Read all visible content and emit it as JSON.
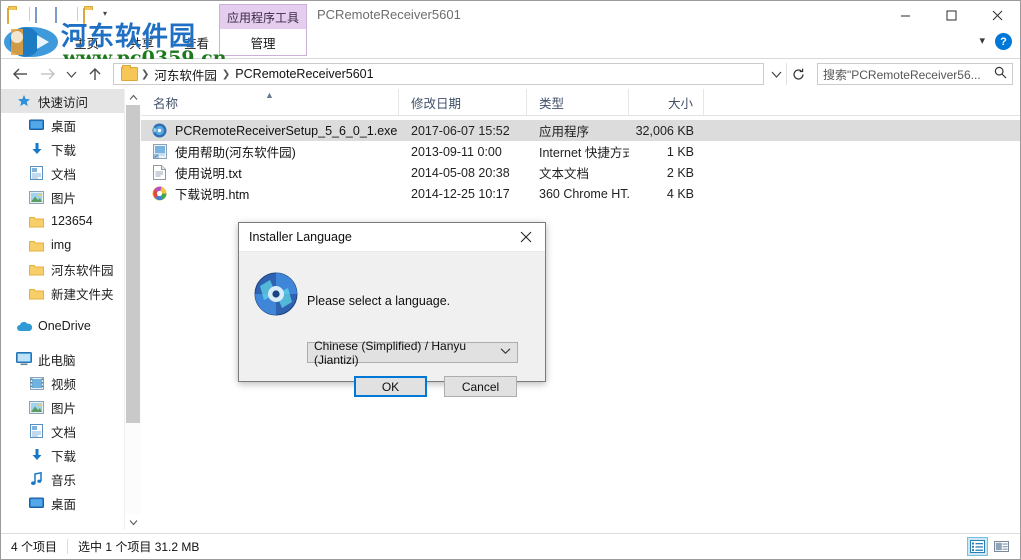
{
  "window": {
    "title": "PCRemoteReceiver5601",
    "controls": {
      "minimize": "minimize-icon",
      "maximize": "maximize-icon",
      "close": "close-icon"
    },
    "ribbon_toggle": "chevron-down-icon",
    "help": "?"
  },
  "ribbon": {
    "tabs": [
      {
        "label": "主页",
        "active": false
      },
      {
        "label": "共享",
        "active": false
      },
      {
        "label": "查看",
        "active": false
      }
    ],
    "contextual": {
      "group_label": "应用程序工具",
      "tab_label": "管理",
      "accent": "#e4cdee"
    }
  },
  "address_bar": {
    "back": "back-arrow-icon",
    "forward": "forward-arrow-icon",
    "recent": "chevron-down-icon",
    "up": "up-arrow-icon",
    "crumbs": [
      "河东软件园",
      "PCRemoteReceiver5601"
    ],
    "dropdown": "chevron-down-icon",
    "refresh": "refresh-icon",
    "search": {
      "value": "搜索\"PCRemoteReceiver56...",
      "placeholder": "搜索\"PCRemoteReceiver56...",
      "icon": "search-icon"
    }
  },
  "sidebar": {
    "quick_access": {
      "label": "快速访问",
      "icon": "star-icon",
      "selected": true
    },
    "items": [
      {
        "label": "桌面",
        "icon": "desktop-icon",
        "pinned": true,
        "level": 1
      },
      {
        "label": "下载",
        "icon": "download-icon",
        "pinned": true,
        "level": 1
      },
      {
        "label": "文档",
        "icon": "documents-icon",
        "pinned": true,
        "level": 1
      },
      {
        "label": "图片",
        "icon": "pictures-icon",
        "pinned": true,
        "level": 1
      },
      {
        "label": "123654",
        "icon": "folder-icon",
        "pinned": false,
        "level": 1
      },
      {
        "label": "img",
        "icon": "folder-icon",
        "pinned": false,
        "level": 1
      },
      {
        "label": "河东软件园",
        "icon": "folder-icon",
        "pinned": false,
        "level": 1
      },
      {
        "label": "新建文件夹",
        "icon": "folder-icon",
        "pinned": false,
        "level": 1
      }
    ],
    "onedrive": {
      "label": "OneDrive",
      "icon": "cloud-icon"
    },
    "this_pc": {
      "label": "此电脑",
      "icon": "computer-icon"
    },
    "this_pc_children": [
      {
        "label": "视频",
        "icon": "videos-icon"
      },
      {
        "label": "图片",
        "icon": "pictures-icon"
      },
      {
        "label": "文档",
        "icon": "documents-icon"
      },
      {
        "label": "下载",
        "icon": "download-icon"
      },
      {
        "label": "音乐",
        "icon": "music-icon"
      },
      {
        "label": "桌面",
        "icon": "desktop-icon"
      }
    ],
    "scroll_up": "chevron-up-icon",
    "scroll_down": "chevron-down-icon"
  },
  "file_list": {
    "columns": [
      {
        "label": "名称",
        "sorted": "asc"
      },
      {
        "label": "修改日期",
        "sorted": ""
      },
      {
        "label": "类型",
        "sorted": ""
      },
      {
        "label": "大小",
        "sorted": ""
      }
    ],
    "rows": [
      {
        "name": "PCRemoteReceiverSetup_5_6_0_1.exe",
        "date": "2017-06-07 15:52",
        "type": "应用程序",
        "size": "32,006 KB",
        "icon": "installer-icon",
        "selected": true
      },
      {
        "name": "使用帮助(河东软件园)",
        "date": "2013-09-11 0:00",
        "type": "Internet 快捷方式",
        "size": "1 KB",
        "icon": "internet-shortcut-icon",
        "selected": false
      },
      {
        "name": "使用说明.txt",
        "date": "2014-05-08 20:38",
        "type": "文本文档",
        "size": "2 KB",
        "icon": "text-file-icon",
        "selected": false
      },
      {
        "name": "下载说明.htm",
        "date": "2014-12-25 10:17",
        "type": "360 Chrome HT...",
        "size": "4 KB",
        "icon": "chrome-html-icon",
        "selected": false
      }
    ]
  },
  "status_bar": {
    "count": "4 个项目",
    "selection": "选中 1 个项目  31.2 MB",
    "view_details": "details-view-icon",
    "view_tiles": "large-icons-view-icon"
  },
  "dialog": {
    "title": "Installer Language",
    "close": "close-icon",
    "icon": "installer-disc-icon",
    "message": "Please select a language.",
    "language_value": "Chinese (Simplified) / Hanyu (Jiantizi)",
    "dropdown_icon": "chevron-down-icon",
    "ok": "OK",
    "cancel": "Cancel",
    "focus_color": "#0078d7"
  },
  "watermark": {
    "text_cn": "河东软件园",
    "text_url": "www.pc0359.cn"
  }
}
